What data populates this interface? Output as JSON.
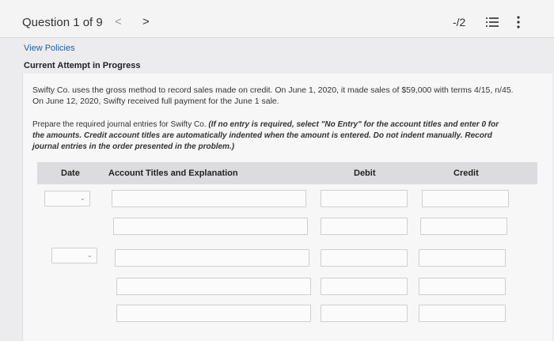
{
  "header": {
    "question_label": "Question 1 of 9",
    "prev_glyph": "<",
    "next_glyph": ">",
    "score": "-/2",
    "list_icon": "list-icon",
    "more_icon": "kebab-icon"
  },
  "content": {
    "view_policies": "View Policies",
    "attempt_label": "Current Attempt in Progress"
  },
  "problem": {
    "text": "Swifty Co. uses the gross method to record sales made on credit. On June 1, 2020, it made sales of $59,000 with terms 4/15, n/45. On June 12, 2020, Swifty received full payment for the June 1 sale.",
    "instructions_plain": "Prepare the required journal entries for Swifty Co. ",
    "instructions_bold": "(If no entry is required, select \"No Entry\" for the account titles and enter 0 for the amounts. Credit account titles are automatically indented when the amount is entered. Do not indent manually. Record journal entries in the order presented in the problem.)"
  },
  "table": {
    "headers": {
      "date": "Date",
      "account": "Account Titles and Explanation",
      "debit": "Debit",
      "credit": "Credit"
    },
    "date_chevron": "⌄"
  }
}
